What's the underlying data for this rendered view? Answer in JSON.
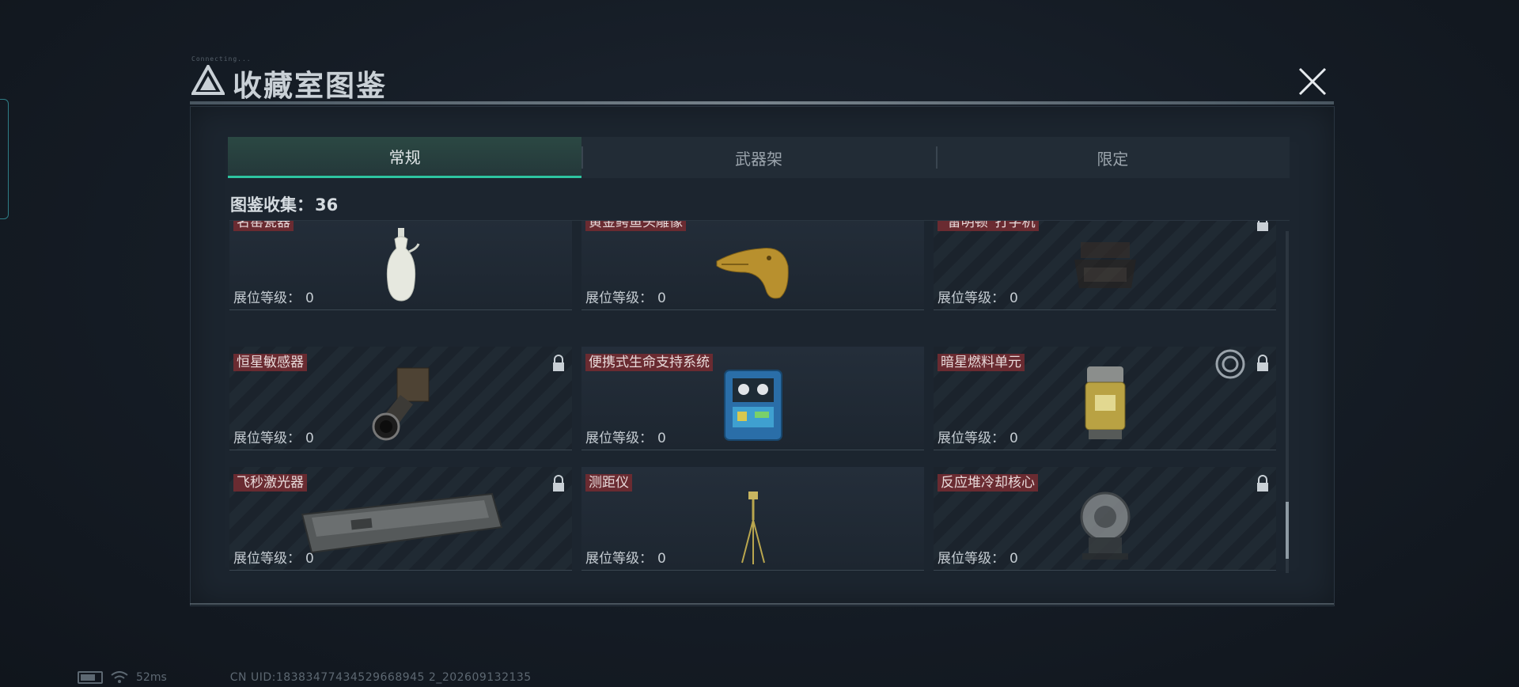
{
  "header": {
    "title": "收藏室图鉴",
    "tiny_text": "Connecting...",
    "close_icon": "close-x-icon"
  },
  "tabs": [
    {
      "label": "常规",
      "active": true
    },
    {
      "label": "武器架",
      "active": false
    },
    {
      "label": "限定",
      "active": false
    }
  ],
  "collection": {
    "label": "图鉴收集：",
    "count": "36"
  },
  "level_label": "展位等级：",
  "items": [
    {
      "name": "名窑瓷器",
      "level": "0",
      "locked": false,
      "icon": "porcelain-vase-icon"
    },
    {
      "name": "黄金鳄鱼头雕像",
      "level": "0",
      "locked": false,
      "icon": "golden-crocodile-head-icon"
    },
    {
      "name": "“雷明顿”打字机",
      "level": "0",
      "locked": true,
      "icon": "typewriter-icon"
    },
    {
      "name": "恒星敏感器",
      "level": "0",
      "locked": true,
      "icon": "star-sensor-icon"
    },
    {
      "name": "便携式生命支持系统",
      "level": "0",
      "locked": false,
      "icon": "life-support-system-icon"
    },
    {
      "name": "暗星燃料单元",
      "level": "0",
      "locked": true,
      "icon": "fuel-cell-icon"
    },
    {
      "name": "飞秒激光器",
      "level": "0",
      "locked": true,
      "icon": "laser-box-icon"
    },
    {
      "name": "测距仪",
      "level": "0",
      "locked": false,
      "icon": "rangefinder-tripod-icon"
    },
    {
      "name": "反应堆冷却核心",
      "level": "0",
      "locked": true,
      "icon": "reactor-core-icon"
    }
  ],
  "status": {
    "ping": "52ms",
    "uid": "CN UID:18383477434529668945 2_202609132135"
  },
  "colors": {
    "accent": "#2ec4a0",
    "tag": "#6a2b31",
    "background": "#151c25"
  }
}
